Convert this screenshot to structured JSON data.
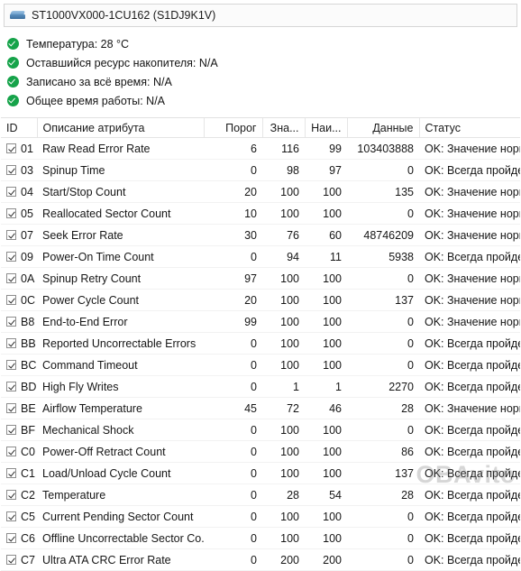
{
  "device": {
    "icon": "hard-drive-icon",
    "label": "ST1000VX000-1CU162 (S1DJ9K1V)"
  },
  "summary": {
    "status_icon": "check-circle-icon",
    "items": [
      {
        "text": "Температура: 28 °C"
      },
      {
        "text": "Оставшийся ресурс накопителя: N/A"
      },
      {
        "text": "Записано за всё время: N/A"
      },
      {
        "text": "Общее время работы: N/A"
      }
    ]
  },
  "table": {
    "columns": [
      {
        "key": "id",
        "label": "ID"
      },
      {
        "key": "desc",
        "label": "Описание атрибута"
      },
      {
        "key": "thr",
        "label": "Порог"
      },
      {
        "key": "val",
        "label": "Зна..."
      },
      {
        "key": "wst",
        "label": "Наи..."
      },
      {
        "key": "data",
        "label": "Данные"
      },
      {
        "key": "status",
        "label": "Статус"
      }
    ],
    "rows": [
      {
        "checked": true,
        "id": "01",
        "desc": "Raw Read Error Rate",
        "thr": "6",
        "val": "116",
        "wst": "99",
        "data": "103403888",
        "status": "OK: Значение нормальное"
      },
      {
        "checked": true,
        "id": "03",
        "desc": "Spinup Time",
        "thr": "0",
        "val": "98",
        "wst": "97",
        "data": "0",
        "status": "OK: Всегда пройдено"
      },
      {
        "checked": true,
        "id": "04",
        "desc": "Start/Stop Count",
        "thr": "20",
        "val": "100",
        "wst": "100",
        "data": "135",
        "status": "OK: Значение нормальное"
      },
      {
        "checked": true,
        "id": "05",
        "desc": "Reallocated Sector Count",
        "thr": "10",
        "val": "100",
        "wst": "100",
        "data": "0",
        "status": "OK: Значение нормальное"
      },
      {
        "checked": true,
        "id": "07",
        "desc": "Seek Error Rate",
        "thr": "30",
        "val": "76",
        "wst": "60",
        "data": "48746209",
        "status": "OK: Значение нормальное"
      },
      {
        "checked": true,
        "id": "09",
        "desc": "Power-On Time Count",
        "thr": "0",
        "val": "94",
        "wst": "11",
        "data": "5938",
        "status": "OK: Всегда пройдено"
      },
      {
        "checked": true,
        "id": "0A",
        "desc": "Spinup Retry Count",
        "thr": "97",
        "val": "100",
        "wst": "100",
        "data": "0",
        "status": "OK: Значение нормальное"
      },
      {
        "checked": true,
        "id": "0C",
        "desc": "Power Cycle Count",
        "thr": "20",
        "val": "100",
        "wst": "100",
        "data": "137",
        "status": "OK: Значение нормальное"
      },
      {
        "checked": true,
        "id": "B8",
        "desc": "End-to-End Error",
        "thr": "99",
        "val": "100",
        "wst": "100",
        "data": "0",
        "status": "OK: Значение нормальное"
      },
      {
        "checked": true,
        "id": "BB",
        "desc": "Reported Uncorrectable Errors",
        "thr": "0",
        "val": "100",
        "wst": "100",
        "data": "0",
        "status": "OK: Всегда пройдено"
      },
      {
        "checked": true,
        "id": "BC",
        "desc": "Command Timeout",
        "thr": "0",
        "val": "100",
        "wst": "100",
        "data": "0",
        "status": "OK: Всегда пройдено"
      },
      {
        "checked": true,
        "id": "BD",
        "desc": "High Fly Writes",
        "thr": "0",
        "val": "1",
        "wst": "1",
        "data": "2270",
        "status": "OK: Всегда пройдено"
      },
      {
        "checked": true,
        "id": "BE",
        "desc": "Airflow Temperature",
        "thr": "45",
        "val": "72",
        "wst": "46",
        "data": "28",
        "status": "OK: Значение нормальное"
      },
      {
        "checked": true,
        "id": "BF",
        "desc": "Mechanical Shock",
        "thr": "0",
        "val": "100",
        "wst": "100",
        "data": "0",
        "status": "OK: Всегда пройдено"
      },
      {
        "checked": true,
        "id": "C0",
        "desc": "Power-Off Retract Count",
        "thr": "0",
        "val": "100",
        "wst": "100",
        "data": "86",
        "status": "OK: Всегда пройдено"
      },
      {
        "checked": true,
        "id": "C1",
        "desc": "Load/Unload Cycle Count",
        "thr": "0",
        "val": "100",
        "wst": "100",
        "data": "137",
        "status": "OK: Всегда пройдено"
      },
      {
        "checked": true,
        "id": "C2",
        "desc": "Temperature",
        "thr": "0",
        "val": "28",
        "wst": "54",
        "data": "28",
        "status": "OK: Всегда пройдено"
      },
      {
        "checked": true,
        "id": "C5",
        "desc": "Current Pending Sector Count",
        "thr": "0",
        "val": "100",
        "wst": "100",
        "data": "0",
        "status": "OK: Всегда пройдено"
      },
      {
        "checked": true,
        "id": "C6",
        "desc": "Offline Uncorrectable Sector Co...",
        "thr": "0",
        "val": "100",
        "wst": "100",
        "data": "0",
        "status": "OK: Всегда пройдено"
      },
      {
        "checked": true,
        "id": "C7",
        "desc": "Ultra ATA CRC Error Rate",
        "thr": "0",
        "val": "200",
        "wst": "200",
        "data": "0",
        "status": "OK: Всегда пройдено"
      }
    ]
  },
  "watermark": {
    "text": "OBAvito"
  },
  "colors": {
    "ok_green": "#16a34a",
    "text": "#161616",
    "border": "#e2e2e2"
  }
}
